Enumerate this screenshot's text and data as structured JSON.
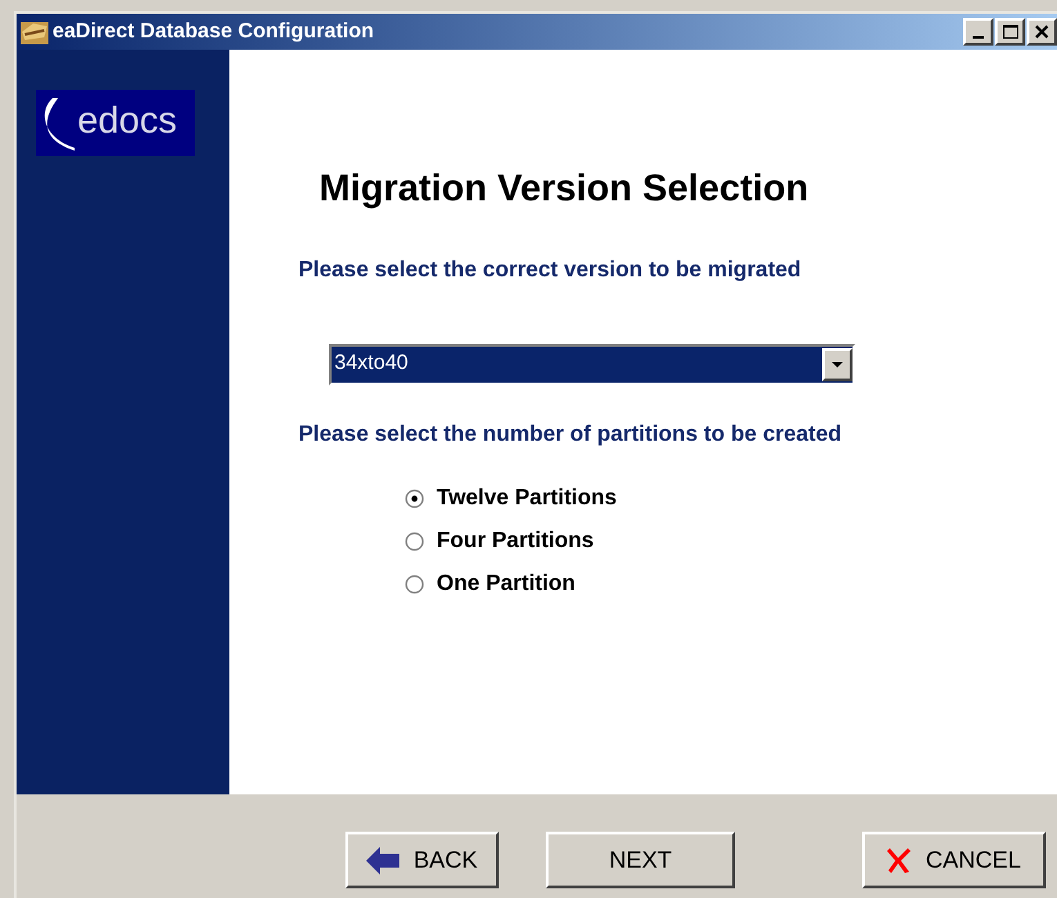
{
  "window": {
    "title": "eaDirect Database Configuration"
  },
  "logo": {
    "text": "edocs"
  },
  "heading": "Migration Version Selection",
  "version_prompt": "Please select the correct version to be migrated",
  "version_select": {
    "value": "34xto40"
  },
  "partition_prompt": "Please select the number of partitions to be created",
  "partitions": [
    {
      "label": "Twelve Partitions",
      "selected": true
    },
    {
      "label": "Four Partitions",
      "selected": false
    },
    {
      "label": "One Partition",
      "selected": false
    }
  ],
  "buttons": [
    {
      "kind": "back",
      "label": "BACK"
    },
    {
      "kind": "next",
      "label": "NEXT"
    },
    {
      "kind": "cancel",
      "label": "CANCEL"
    }
  ]
}
